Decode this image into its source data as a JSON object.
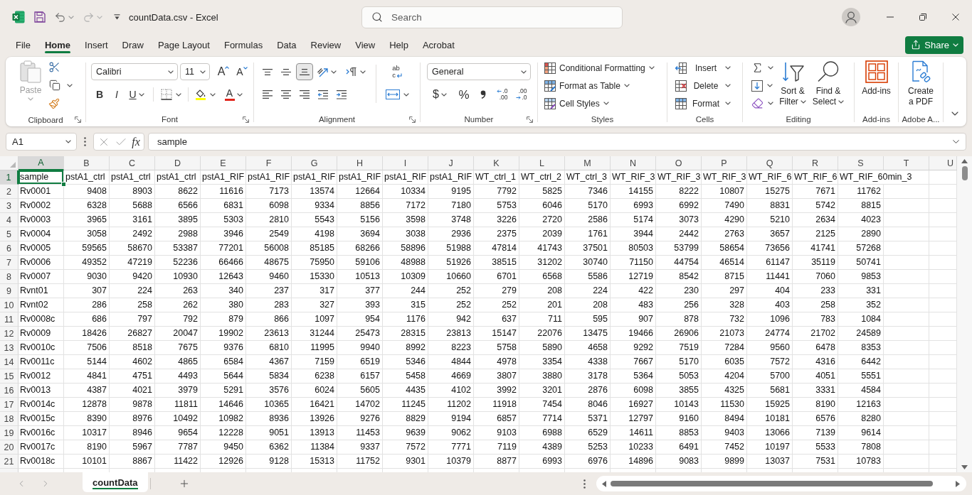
{
  "window": {
    "title": "countData.csv - Excel"
  },
  "search": {
    "placeholder": "Search"
  },
  "ribbon_tabs": [
    {
      "label": "File",
      "selected": false
    },
    {
      "label": "Home",
      "selected": true
    },
    {
      "label": "Insert",
      "selected": false
    },
    {
      "label": "Draw",
      "selected": false
    },
    {
      "label": "Page Layout",
      "selected": false
    },
    {
      "label": "Formulas",
      "selected": false
    },
    {
      "label": "Data",
      "selected": false
    },
    {
      "label": "Review",
      "selected": false
    },
    {
      "label": "View",
      "selected": false
    },
    {
      "label": "Help",
      "selected": false
    },
    {
      "label": "Acrobat",
      "selected": false
    }
  ],
  "share_button": {
    "label": "Share"
  },
  "ribbon_groups": [
    {
      "kind": "clipboard",
      "label": "Clipboard",
      "launcher": true,
      "paste": {
        "label": "Paste",
        "disabled": true
      }
    },
    {
      "kind": "font",
      "label": "Font",
      "launcher": true,
      "font_name": "Calibri",
      "font_size": "11",
      "grow_font": "A",
      "shrink_font": "A",
      "bold": "B",
      "italic": "I",
      "underline": "U",
      "font_color": "A"
    },
    {
      "kind": "alignment",
      "label": "Alignment",
      "launcher": true,
      "vertical_align": [
        {
          "kind": "top",
          "selected": false
        },
        {
          "kind": "middle",
          "selected": false
        },
        {
          "kind": "bottom",
          "selected": true
        }
      ],
      "horizontal_align": [
        {
          "kind": "left",
          "selected": false
        },
        {
          "kind": "center",
          "selected": false
        },
        {
          "kind": "right",
          "selected": false
        }
      ],
      "wrap_text": {
        "top": "ab",
        "bottom": "c"
      }
    },
    {
      "kind": "number",
      "label": "Number",
      "launcher": true,
      "format": "General",
      "currency": "$",
      "percent": "%",
      "increase_decimal": {
        "top": ".0",
        "bottom": ".00"
      },
      "decrease_decimal": {
        "top": ".00",
        "bottom": ".0"
      }
    },
    {
      "kind": "styles",
      "label": "Styles",
      "launcher": false,
      "items": [
        {
          "kind": "conditional",
          "label": "Conditional Formatting"
        },
        {
          "kind": "table",
          "label": "Format as Table"
        },
        {
          "kind": "cell_styles",
          "label": "Cell Styles"
        }
      ]
    },
    {
      "kind": "cells",
      "label": "Cells",
      "launcher": false,
      "items": [
        {
          "kind": "insert",
          "label": "Insert"
        },
        {
          "kind": "delete",
          "label": "Delete"
        },
        {
          "kind": "format",
          "label": "Format"
        }
      ]
    },
    {
      "kind": "editing",
      "label": "Editing",
      "launcher": false,
      "sort": [
        "Sort &",
        "Filter"
      ],
      "find": [
        "Find &",
        "Select"
      ]
    },
    {
      "kind": "addins",
      "label": "Add-ins",
      "launcher": false,
      "button": [
        "Add-ins"
      ]
    },
    {
      "kind": "adobe",
      "label": "Adobe A...",
      "launcher": false,
      "button": [
        "Create",
        "a PDF"
      ]
    }
  ],
  "formula_bar": {
    "name_box": "A1",
    "function_label": "fx",
    "formula": "sample"
  },
  "sheet": {
    "columns": [
      {
        "label": "A",
        "selected": true
      },
      {
        "label": "B",
        "selected": false
      },
      {
        "label": "C",
        "selected": false
      },
      {
        "label": "D",
        "selected": false
      },
      {
        "label": "E",
        "selected": false
      },
      {
        "label": "F",
        "selected": false
      },
      {
        "label": "G",
        "selected": false
      },
      {
        "label": "H",
        "selected": false
      },
      {
        "label": "I",
        "selected": false
      },
      {
        "label": "J",
        "selected": false
      },
      {
        "label": "K",
        "selected": false
      },
      {
        "label": "L",
        "selected": false
      },
      {
        "label": "M",
        "selected": false
      },
      {
        "label": "N",
        "selected": false
      },
      {
        "label": "O",
        "selected": false
      },
      {
        "label": "P",
        "selected": false
      },
      {
        "label": "Q",
        "selected": false
      },
      {
        "label": "R",
        "selected": false
      },
      {
        "label": "S",
        "selected": false
      },
      {
        "label": "T",
        "selected": false
      },
      {
        "label": "U",
        "selected": false
      }
    ],
    "rows": [
      {
        "number": "1",
        "selected": true,
        "kind": "text",
        "cells": [
          "sample",
          "pstA1_ctrl",
          "pstA1_ctrl",
          "pstA1_ctrl",
          "pstA1_RIF",
          "pstA1_RIF",
          "pstA1_RIF",
          "pstA1_RIF",
          "pstA1_RIF",
          "pstA1_RIF",
          "WT_ctrl_1",
          "WT_ctrl_2",
          "WT_ctrl_3",
          "WT_RIF_3",
          "WT_RIF_3",
          "WT_RIF_3",
          "WT_RIF_6",
          "WT_RIF_6",
          "WT_RIF_60min_3"
        ]
      },
      {
        "number": "2",
        "selected": false,
        "kind": "numeric",
        "cells": [
          "Rv0001",
          "9408",
          "8903",
          "8622",
          "11616",
          "7173",
          "13574",
          "12664",
          "10334",
          "9195",
          "7792",
          "5825",
          "7346",
          "14155",
          "8222",
          "10807",
          "15275",
          "7671",
          "11762"
        ]
      },
      {
        "number": "3",
        "selected": false,
        "kind": "numeric",
        "cells": [
          "Rv0002",
          "6328",
          "5688",
          "6566",
          "6831",
          "6098",
          "9334",
          "8856",
          "7172",
          "7180",
          "5753",
          "6046",
          "5170",
          "6993",
          "6992",
          "7490",
          "8831",
          "5742",
          "8815"
        ]
      },
      {
        "number": "4",
        "selected": false,
        "kind": "numeric",
        "cells": [
          "Rv0003",
          "3965",
          "3161",
          "3895",
          "5303",
          "2810",
          "5543",
          "5156",
          "3598",
          "3748",
          "3226",
          "2720",
          "2586",
          "5174",
          "3073",
          "4290",
          "5210",
          "2634",
          "4023"
        ]
      },
      {
        "number": "5",
        "selected": false,
        "kind": "numeric",
        "cells": [
          "Rv0004",
          "3058",
          "2492",
          "2988",
          "3946",
          "2549",
          "4198",
          "3694",
          "3038",
          "2936",
          "2375",
          "2039",
          "1761",
          "3944",
          "2442",
          "2763",
          "3657",
          "2125",
          "2890"
        ]
      },
      {
        "number": "6",
        "selected": false,
        "kind": "numeric",
        "cells": [
          "Rv0005",
          "59565",
          "58670",
          "53387",
          "77201",
          "56008",
          "85185",
          "68266",
          "58896",
          "51988",
          "47814",
          "41743",
          "37501",
          "80503",
          "53799",
          "58654",
          "73656",
          "41741",
          "57268"
        ]
      },
      {
        "number": "7",
        "selected": false,
        "kind": "numeric",
        "cells": [
          "Rv0006",
          "49352",
          "47219",
          "52236",
          "66466",
          "48675",
          "75950",
          "59106",
          "48988",
          "51926",
          "38515",
          "31202",
          "30740",
          "71150",
          "44754",
          "46514",
          "61147",
          "35119",
          "50741"
        ]
      },
      {
        "number": "8",
        "selected": false,
        "kind": "numeric",
        "cells": [
          "Rv0007",
          "9030",
          "9420",
          "10930",
          "12643",
          "9460",
          "15330",
          "10513",
          "10309",
          "10660",
          "6701",
          "6568",
          "5586",
          "12719",
          "8542",
          "8715",
          "11441",
          "7060",
          "9853"
        ]
      },
      {
        "number": "9",
        "selected": false,
        "kind": "numeric",
        "cells": [
          "Rvnt01",
          "307",
          "224",
          "263",
          "340",
          "237",
          "317",
          "377",
          "244",
          "252",
          "279",
          "208",
          "224",
          "422",
          "230",
          "297",
          "404",
          "233",
          "331"
        ]
      },
      {
        "number": "10",
        "selected": false,
        "kind": "numeric",
        "cells": [
          "Rvnt02",
          "286",
          "258",
          "262",
          "380",
          "283",
          "327",
          "393",
          "315",
          "252",
          "252",
          "201",
          "208",
          "483",
          "256",
          "328",
          "403",
          "258",
          "352"
        ]
      },
      {
        "number": "11",
        "selected": false,
        "kind": "numeric",
        "cells": [
          "Rv0008c",
          "686",
          "797",
          "792",
          "879",
          "866",
          "1097",
          "954",
          "1176",
          "942",
          "637",
          "711",
          "595",
          "907",
          "878",
          "732",
          "1096",
          "783",
          "1084"
        ]
      },
      {
        "number": "12",
        "selected": false,
        "kind": "numeric",
        "cells": [
          "Rv0009",
          "18426",
          "26827",
          "20047",
          "19902",
          "23613",
          "31244",
          "25473",
          "28315",
          "23813",
          "15147",
          "22076",
          "13475",
          "19466",
          "26906",
          "21073",
          "24774",
          "21702",
          "24589"
        ]
      },
      {
        "number": "13",
        "selected": false,
        "kind": "numeric",
        "cells": [
          "Rv0010c",
          "7506",
          "8518",
          "7675",
          "9376",
          "6810",
          "11995",
          "9940",
          "8992",
          "8223",
          "5758",
          "5890",
          "4658",
          "9292",
          "7519",
          "7284",
          "9560",
          "6478",
          "8353"
        ]
      },
      {
        "number": "14",
        "selected": false,
        "kind": "numeric",
        "cells": [
          "Rv0011c",
          "5144",
          "4602",
          "4865",
          "6584",
          "4367",
          "7159",
          "6519",
          "5346",
          "4844",
          "4978",
          "3354",
          "4338",
          "7667",
          "5170",
          "6035",
          "7572",
          "4316",
          "6442"
        ]
      },
      {
        "number": "15",
        "selected": false,
        "kind": "numeric",
        "cells": [
          "Rv0012",
          "4841",
          "4751",
          "4493",
          "5644",
          "5834",
          "6238",
          "6157",
          "5458",
          "4669",
          "3807",
          "3880",
          "3178",
          "5364",
          "5053",
          "4204",
          "5700",
          "4051",
          "5551"
        ]
      },
      {
        "number": "16",
        "selected": false,
        "kind": "numeric",
        "cells": [
          "Rv0013",
          "4387",
          "4021",
          "3979",
          "5291",
          "3576",
          "6024",
          "5605",
          "4435",
          "4102",
          "3992",
          "3201",
          "2876",
          "6098",
          "3855",
          "4325",
          "5681",
          "3331",
          "4584"
        ]
      },
      {
        "number": "17",
        "selected": false,
        "kind": "numeric",
        "cells": [
          "Rv0014c",
          "12878",
          "9878",
          "11811",
          "14646",
          "10365",
          "16421",
          "14702",
          "11245",
          "11202",
          "11918",
          "7454",
          "8046",
          "16927",
          "10143",
          "11530",
          "15925",
          "8190",
          "12163"
        ]
      },
      {
        "number": "18",
        "selected": false,
        "kind": "numeric",
        "cells": [
          "Rv0015c",
          "8390",
          "8976",
          "10492",
          "10982",
          "8936",
          "13926",
          "9276",
          "8829",
          "9194",
          "6857",
          "7714",
          "5371",
          "12797",
          "9160",
          "8494",
          "10181",
          "6576",
          "8280"
        ]
      },
      {
        "number": "19",
        "selected": false,
        "kind": "numeric",
        "cells": [
          "Rv0016c",
          "10317",
          "8946",
          "9654",
          "12228",
          "9051",
          "13913",
          "11453",
          "9639",
          "9062",
          "9103",
          "6988",
          "6529",
          "14611",
          "8853",
          "9403",
          "13066",
          "7139",
          "9614"
        ]
      },
      {
        "number": "20",
        "selected": false,
        "kind": "numeric",
        "cells": [
          "Rv0017c",
          "8190",
          "5967",
          "7787",
          "9450",
          "6362",
          "11384",
          "9337",
          "7572",
          "7771",
          "7119",
          "4389",
          "5253",
          "10233",
          "6491",
          "7452",
          "10197",
          "5533",
          "7808"
        ]
      },
      {
        "number": "21",
        "selected": false,
        "kind": "numeric",
        "cells": [
          "Rv0018c",
          "10101",
          "8867",
          "11422",
          "12926",
          "9128",
          "15313",
          "11752",
          "9301",
          "10379",
          "8877",
          "6993",
          "6976",
          "14896",
          "9083",
          "9899",
          "13037",
          "7531",
          "10783"
        ]
      }
    ]
  },
  "sheet_tabs": [
    {
      "label": "countData",
      "selected": true
    }
  ]
}
